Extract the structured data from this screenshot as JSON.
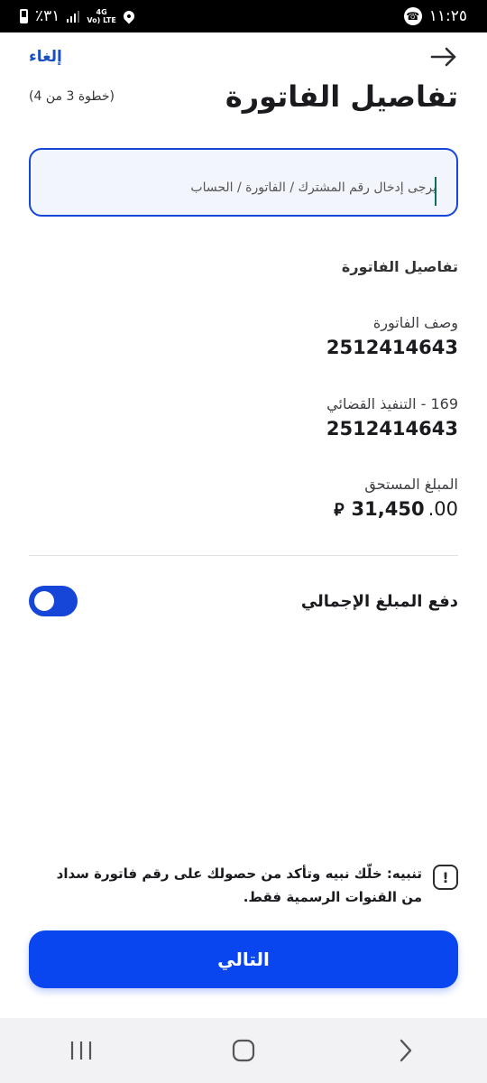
{
  "status_bar": {
    "time": "١١:٢٥",
    "battery": "٪٣١",
    "network_line1": "4G",
    "network_line2": "Vo) LTE"
  },
  "header": {
    "cancel_label": "إلغاء",
    "title": "تفاصيل الفاتورة",
    "step": "(خطوة 3 من 4)"
  },
  "account_input": {
    "placeholder": "يرجى إدخال رقم المشترك / الفاتورة / الحساب",
    "value": ""
  },
  "details": {
    "heading": "تفاصيل الفاتورة",
    "items": [
      {
        "label": "وصف الفاتورة",
        "value": "2512414643"
      },
      {
        "label": "169 - التنفيذ القضائي",
        "value": "2512414643"
      }
    ],
    "amount": {
      "label": "المبلغ المستحق",
      "integer": "31,450",
      "decimal": ".00",
      "currency_symbol": "⃁"
    }
  },
  "toggle": {
    "label": "دفع المبلغ الإجمالي",
    "state": "on",
    "color": "#1546d8"
  },
  "notice": {
    "icon": "exclamation-icon",
    "text": "تنبيه: خلّك نبيه وتأكد من حصولك على رقم فاتورة سداد من القنوات الرسمية فقط."
  },
  "next_button": {
    "label": "التالي",
    "color": "#0a46f0"
  },
  "nav_bar": {
    "icons": [
      "recent-apps-icon",
      "home-icon",
      "back-icon"
    ]
  }
}
